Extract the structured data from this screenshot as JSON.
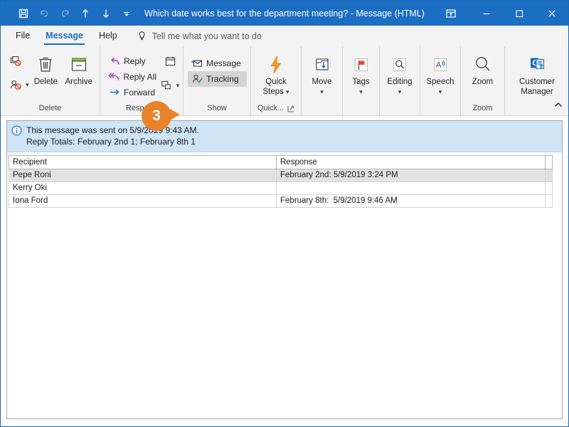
{
  "window": {
    "title": "Which date works best for the department meeting?  -  Message (HTML)",
    "accent_color": "#1b6ec2",
    "callout_color": "#e8832a"
  },
  "quick_access_toolbar": {
    "items": [
      {
        "name": "save",
        "icon": "save-icon",
        "label": "Save"
      },
      {
        "name": "undo",
        "icon": "undo-icon",
        "label": "Undo",
        "disabled": true
      },
      {
        "name": "redo",
        "icon": "redo-icon",
        "label": "Redo",
        "disabled": true
      },
      {
        "name": "previous-item",
        "icon": "arrow-up-icon",
        "label": "Previous Item"
      },
      {
        "name": "next-item",
        "icon": "arrow-down-icon",
        "label": "Next Item"
      },
      {
        "name": "customize",
        "icon": "chevron-down-icon",
        "label": "Customize Quick Access Toolbar"
      }
    ]
  },
  "window_controls": {
    "ribbon_display": "Ribbon Display Options",
    "minimize": "Minimize",
    "maximize": "Maximize",
    "close": "Close"
  },
  "tabs": [
    {
      "label": "File",
      "active": false
    },
    {
      "label": "Message",
      "active": true
    },
    {
      "label": "Help",
      "active": false
    }
  ],
  "tell_me": {
    "placeholder": "Tell me what you want to do",
    "icon": "lightbulb-icon"
  },
  "ribbon": {
    "groups": [
      {
        "label": "Delete",
        "small_items": [
          {
            "label": "",
            "icon": "ignore-icon"
          },
          {
            "label": "",
            "icon": "junk-icon",
            "has_caret": true
          }
        ],
        "big_items": [
          {
            "label": "Delete",
            "icon": "trash-icon"
          },
          {
            "label": "Archive",
            "icon": "archive-icon"
          }
        ]
      },
      {
        "label": "Respond",
        "small_items": [
          {
            "label": "Reply",
            "icon": "reply-icon"
          },
          {
            "label": "Reply All",
            "icon": "reply-all-icon"
          },
          {
            "label": "Forward",
            "icon": "forward-icon"
          }
        ],
        "extra_items": [
          {
            "label": "Meeting",
            "icon": "meeting-icon"
          },
          {
            "label": "More",
            "icon": "more-respond-icon",
            "has_caret": true
          }
        ]
      },
      {
        "label": "Show",
        "small_items": [
          {
            "label": "Message",
            "icon": "message-icon",
            "selected": false
          },
          {
            "label": "Tracking",
            "icon": "tracking-icon",
            "selected": true
          }
        ]
      },
      {
        "label": "Quick...",
        "dialog_launcher": true,
        "big_items": [
          {
            "label": "Quick\nSteps",
            "label_line1": "Quick",
            "label_line2": "Steps",
            "icon": "quick-steps-icon",
            "has_caret": true
          }
        ]
      },
      {
        "label": "",
        "big_items": [
          {
            "label": "Move",
            "icon": "move-icon",
            "has_caret": true
          }
        ]
      },
      {
        "label": "",
        "big_items": [
          {
            "label": "Tags",
            "icon": "tags-icon",
            "has_caret": true
          }
        ]
      },
      {
        "label": "",
        "big_items": [
          {
            "label": "Editing",
            "icon": "editing-icon",
            "has_caret": true
          }
        ]
      },
      {
        "label": "",
        "big_items": [
          {
            "label": "Speech",
            "icon": "speech-icon",
            "has_caret": true
          }
        ]
      },
      {
        "label": "Zoom",
        "big_items": [
          {
            "label": "Zoom",
            "icon": "zoom-icon"
          }
        ]
      },
      {
        "label": "",
        "big_items": [
          {
            "label_line1": "Customer",
            "label_line2": "Manager",
            "icon": "customer-manager-icon"
          }
        ]
      }
    ],
    "collapse_label": "Collapse the Ribbon"
  },
  "callout": {
    "number": "3"
  },
  "info_bar": {
    "icon": "info-icon",
    "line1": "This message was sent on 5/9/2019 9:43 AM.",
    "line2": "Reply Totals: February 2nd 1; February 8th 1"
  },
  "tracking_table": {
    "columns": [
      "Recipient",
      "Response"
    ],
    "rows": [
      {
        "recipient": "Pepe Roni",
        "response_label": "February 2nd:",
        "response_time": "5/9/2019 3:24 PM",
        "selected": true
      },
      {
        "recipient": "Kerry Oki",
        "response_label": "",
        "response_time": "",
        "selected": false
      },
      {
        "recipient": "Iona Ford",
        "response_label": "February 8th:",
        "response_time": "5/9/2019 9:46 AM",
        "selected": false
      }
    ]
  }
}
